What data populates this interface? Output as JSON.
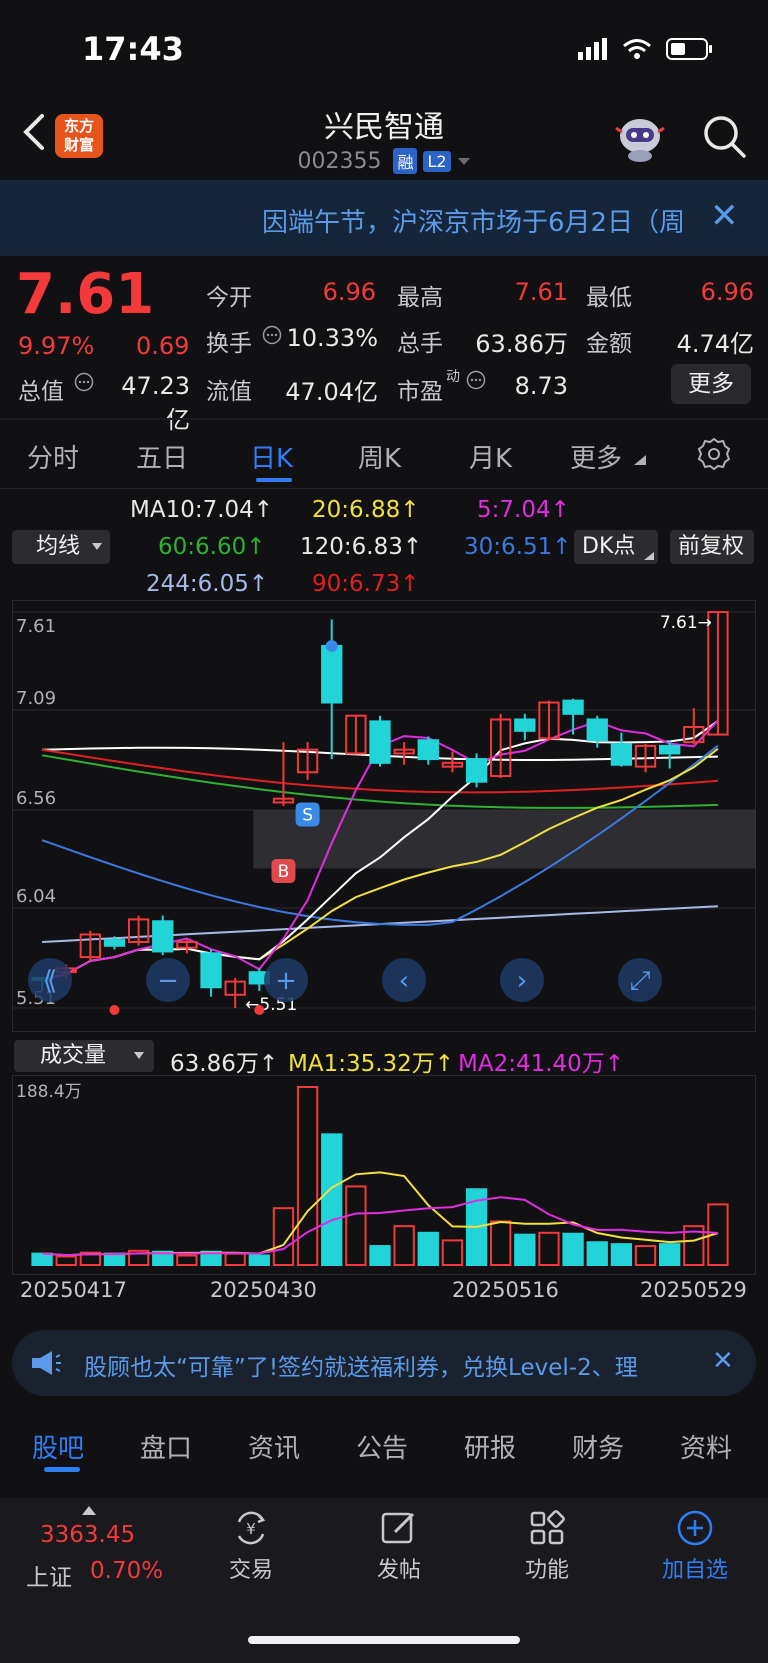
{
  "status": {
    "time": "17:43"
  },
  "header": {
    "logo_line1": "东方",
    "logo_line2": "财富",
    "name": "兴民智通",
    "code": "002355",
    "tag1": "融",
    "tag2": "L2"
  },
  "notice": {
    "text": "因端午节，沪深京市场于6月2日（周",
    "close": "✕"
  },
  "quote": {
    "price": "7.61",
    "pct": "9.97%",
    "change": "0.69",
    "open_label": "今开",
    "open": "6.96",
    "high_label": "最高",
    "high": "7.61",
    "low_label": "最低",
    "low": "6.96",
    "turnover_label": "换手",
    "turnover": "10.33%",
    "volume_label": "总手",
    "volume": "63.86万",
    "amount_label": "金额",
    "amount": "4.74亿",
    "mktcap_label": "总值",
    "mktcap": "47.23亿",
    "float_label": "流值",
    "float": "47.04亿",
    "pe_label": "市盈",
    "pe_sup": "动",
    "pe": "8.73",
    "more": "更多"
  },
  "tabs": [
    "分时",
    "五日",
    "日K",
    "周K",
    "月K",
    "更多"
  ],
  "ma_legend": {
    "selector": "均线",
    "ma10": "MA10:7.04↑",
    "ma20": "20:6.88↑",
    "ma5": "5:7.04↑",
    "ma60": "60:6.60↑",
    "ma120": "120:6.83↑",
    "ma30": "30:6.51↑",
    "ma244": "244:6.05↑",
    "ma90": "90:6.73↑",
    "dk": "DK点",
    "fq": "前复权"
  },
  "colors": {
    "up": "#f23a3a",
    "down": "#22d3d8",
    "accent": "#2f7df5",
    "ma5": "#e02de0",
    "ma10": "#ffffff",
    "ma20": "#f0e040",
    "ma30": "#3a7ae0",
    "ma60": "#30b030",
    "ma90": "#e02020",
    "ma120": "#ffffff",
    "ma244": "#a8b8e8"
  },
  "chart_data": {
    "type": "candlestick",
    "price_axis": [
      "7.61",
      "7.09",
      "6.56",
      "6.04",
      "5.51"
    ],
    "ylim": [
      5.51,
      7.61
    ],
    "last_label": "7.61→",
    "low_label": "5.51",
    "candles": [
      {
        "o": 5.67,
        "c": 5.66,
        "h": 5.67,
        "l": 5.6
      },
      {
        "o": 5.7,
        "c": 5.72,
        "h": 5.74,
        "l": 5.66
      },
      {
        "o": 5.78,
        "c": 5.9,
        "h": 5.92,
        "l": 5.76
      },
      {
        "o": 5.87,
        "c": 5.84,
        "h": 5.89,
        "l": 5.82
      },
      {
        "o": 5.86,
        "c": 5.98,
        "h": 6.0,
        "l": 5.84
      },
      {
        "o": 5.97,
        "c": 5.81,
        "h": 6.0,
        "l": 5.79
      },
      {
        "o": 5.83,
        "c": 5.86,
        "h": 5.88,
        "l": 5.8
      },
      {
        "o": 5.8,
        "c": 5.62,
        "h": 5.82,
        "l": 5.57
      },
      {
        "o": 5.58,
        "c": 5.65,
        "h": 5.67,
        "l": 5.51
      },
      {
        "o": 5.7,
        "c": 5.64,
        "h": 5.72,
        "l": 5.6
      },
      {
        "o": 6.6,
        "c": 6.62,
        "h": 6.92,
        "l": 6.58
      },
      {
        "o": 6.76,
        "c": 6.88,
        "h": 6.92,
        "l": 6.72
      },
      {
        "o": 7.43,
        "c": 7.13,
        "h": 7.57,
        "l": 6.83
      },
      {
        "o": 6.86,
        "c": 7.06,
        "h": 7.06,
        "l": 6.86
      },
      {
        "o": 7.03,
        "c": 6.81,
        "h": 7.06,
        "l": 6.79
      },
      {
        "o": 6.86,
        "c": 6.88,
        "h": 6.92,
        "l": 6.8
      },
      {
        "o": 6.93,
        "c": 6.83,
        "h": 6.95,
        "l": 6.8
      },
      {
        "o": 6.79,
        "c": 6.81,
        "h": 6.87,
        "l": 6.76
      },
      {
        "o": 6.83,
        "c": 6.71,
        "h": 6.86,
        "l": 6.68
      },
      {
        "o": 6.74,
        "c": 7.04,
        "h": 7.07,
        "l": 6.73
      },
      {
        "o": 7.04,
        "c": 6.98,
        "h": 7.07,
        "l": 6.93
      },
      {
        "o": 6.94,
        "c": 7.13,
        "h": 7.14,
        "l": 6.93
      },
      {
        "o": 7.14,
        "c": 7.07,
        "h": 7.15,
        "l": 6.96
      },
      {
        "o": 7.04,
        "c": 6.93,
        "h": 7.06,
        "l": 6.89
      },
      {
        "o": 6.91,
        "c": 6.8,
        "h": 6.97,
        "l": 6.79
      },
      {
        "o": 6.79,
        "c": 6.9,
        "h": 6.91,
        "l": 6.76
      },
      {
        "o": 6.9,
        "c": 6.86,
        "h": 6.93,
        "l": 6.78
      },
      {
        "o": 6.92,
        "c": 7.0,
        "h": 7.1,
        "l": 6.91
      },
      {
        "o": 6.96,
        "c": 7.61,
        "h": 7.61,
        "l": 6.96
      }
    ],
    "marker_b": "B",
    "marker_s": "S",
    "volume": {
      "label": "成交量",
      "value": "63.86万↑",
      "ma1": "MA1:35.32万↑",
      "ma2": "MA2:41.40万↑",
      "ymax_label": "188.4万",
      "values": [
        12,
        9,
        13,
        12,
        15,
        14,
        10,
        14,
        12,
        10,
        60,
        188,
        138,
        83,
        20,
        41,
        34,
        26,
        80,
        46,
        32,
        34,
        33,
        24,
        22,
        20,
        22,
        41,
        64
      ]
    },
    "dates": [
      "20250417",
      "20250430",
      "20250516",
      "20250529"
    ]
  },
  "ad": {
    "text": "股顾也太“可靠”了!签约就送福利券，兑换Level-2、理",
    "close": "✕"
  },
  "bottom_tabs": [
    "股吧",
    "盘口",
    "资讯",
    "公告",
    "研报",
    "财务",
    "资料"
  ],
  "footer": {
    "index_value": "3363.45",
    "index_name": "上证",
    "index_pct": "0.70%",
    "trade": "交易",
    "post": "发帖",
    "func": "功能",
    "add": "加自选"
  }
}
